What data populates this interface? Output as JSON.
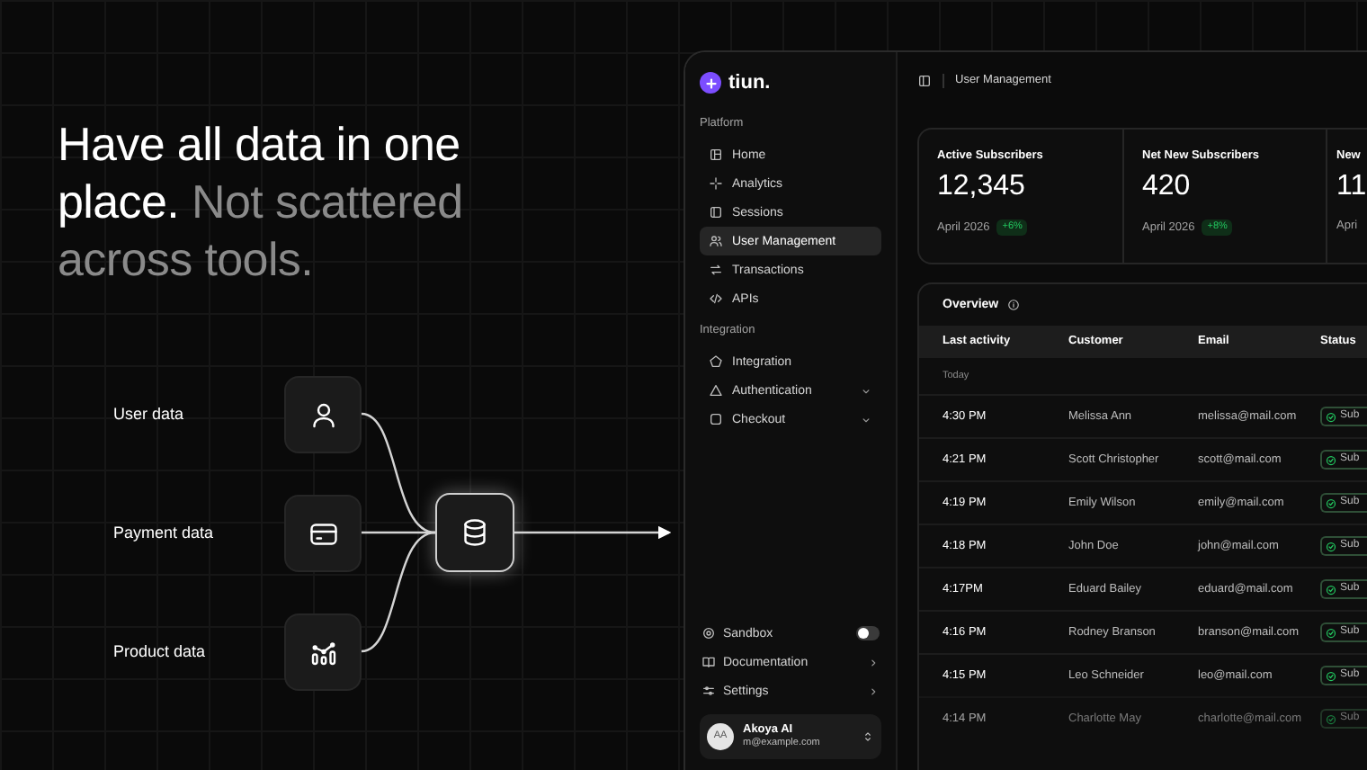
{
  "headline": {
    "text": "Have all data in one place.",
    "muted": "Not scattered across tools."
  },
  "diagram": {
    "sources": [
      {
        "label": "User data",
        "kind": "user"
      },
      {
        "label": "Payment data",
        "kind": "card"
      },
      {
        "label": "Product data",
        "kind": "chart"
      }
    ]
  },
  "app": {
    "brand": "tiun.",
    "sidebar": {
      "sections": [
        {
          "title": "Platform",
          "items": [
            {
              "label": "Home",
              "kind": "home",
              "selected": false,
              "expandable": false
            },
            {
              "label": "Analytics",
              "kind": "sparkle",
              "selected": false,
              "expandable": false
            },
            {
              "label": "Sessions",
              "kind": "sessions",
              "selected": false,
              "expandable": false
            },
            {
              "label": "User Management",
              "kind": "users",
              "selected": true,
              "expandable": false
            },
            {
              "label": "Transactions",
              "kind": "swap",
              "selected": false,
              "expandable": false
            },
            {
              "label": "APIs",
              "kind": "code",
              "selected": false,
              "expandable": false
            }
          ]
        },
        {
          "title": "Integration",
          "items": [
            {
              "label": "Integration",
              "kind": "pentagon",
              "selected": false,
              "expandable": false
            },
            {
              "label": "Authentication",
              "kind": "triangle",
              "selected": false,
              "expandable": true
            },
            {
              "label": "Checkout",
              "kind": "square",
              "selected": false,
              "expandable": true
            }
          ]
        }
      ],
      "footer": [
        {
          "label": "Sandbox",
          "kind": "toggle",
          "on": false
        },
        {
          "label": "Documentation",
          "kind": "link"
        },
        {
          "label": "Settings",
          "kind": "link"
        }
      ],
      "user": {
        "initials": "AA",
        "name": "Akoya AI",
        "email": "m@example.com"
      }
    },
    "breadcrumb": "User Management",
    "stats": [
      {
        "title": "Active Subscribers",
        "value": "12,345",
        "period": "April 2026",
        "change": "+6%"
      },
      {
        "title": "Net New Subscribers",
        "value": "420",
        "period": "April 2026",
        "change": "+8%"
      },
      {
        "title": "New",
        "value": "11",
        "period": "Apri"
      }
    ],
    "table": {
      "title": "Overview",
      "columns": [
        "Last activity",
        "Customer",
        "Email",
        "Status"
      ],
      "group": "Today",
      "rows": [
        {
          "time": "4:30 PM",
          "customer": "Melissa Ann",
          "email": "melissa@mail.com",
          "status": "Sub",
          "faded": false
        },
        {
          "time": "4:21 PM",
          "customer": "Scott Christopher",
          "email": "scott@mail.com",
          "status": "Sub",
          "faded": false
        },
        {
          "time": "4:19 PM",
          "customer": "Emily Wilson",
          "email": "emily@mail.com",
          "status": "Sub",
          "faded": false
        },
        {
          "time": "4:18 PM",
          "customer": "John Doe",
          "email": "john@mail.com",
          "status": "Sub",
          "faded": false
        },
        {
          "time": "4:17PM",
          "customer": "Eduard Bailey",
          "email": "eduard@mail.com",
          "status": "Sub",
          "faded": false
        },
        {
          "time": "4:16 PM",
          "customer": "Rodney Branson",
          "email": "branson@mail.com",
          "status": "Sub",
          "faded": false
        },
        {
          "time": "4:15 PM",
          "customer": "Leo Schneider",
          "email": "leo@mail.com",
          "status": "Sub",
          "faded": false
        },
        {
          "time": "4:14 PM",
          "customer": "Charlotte May",
          "email": "charlotte@mail.com",
          "status": "Sub",
          "faded": true
        }
      ]
    }
  }
}
